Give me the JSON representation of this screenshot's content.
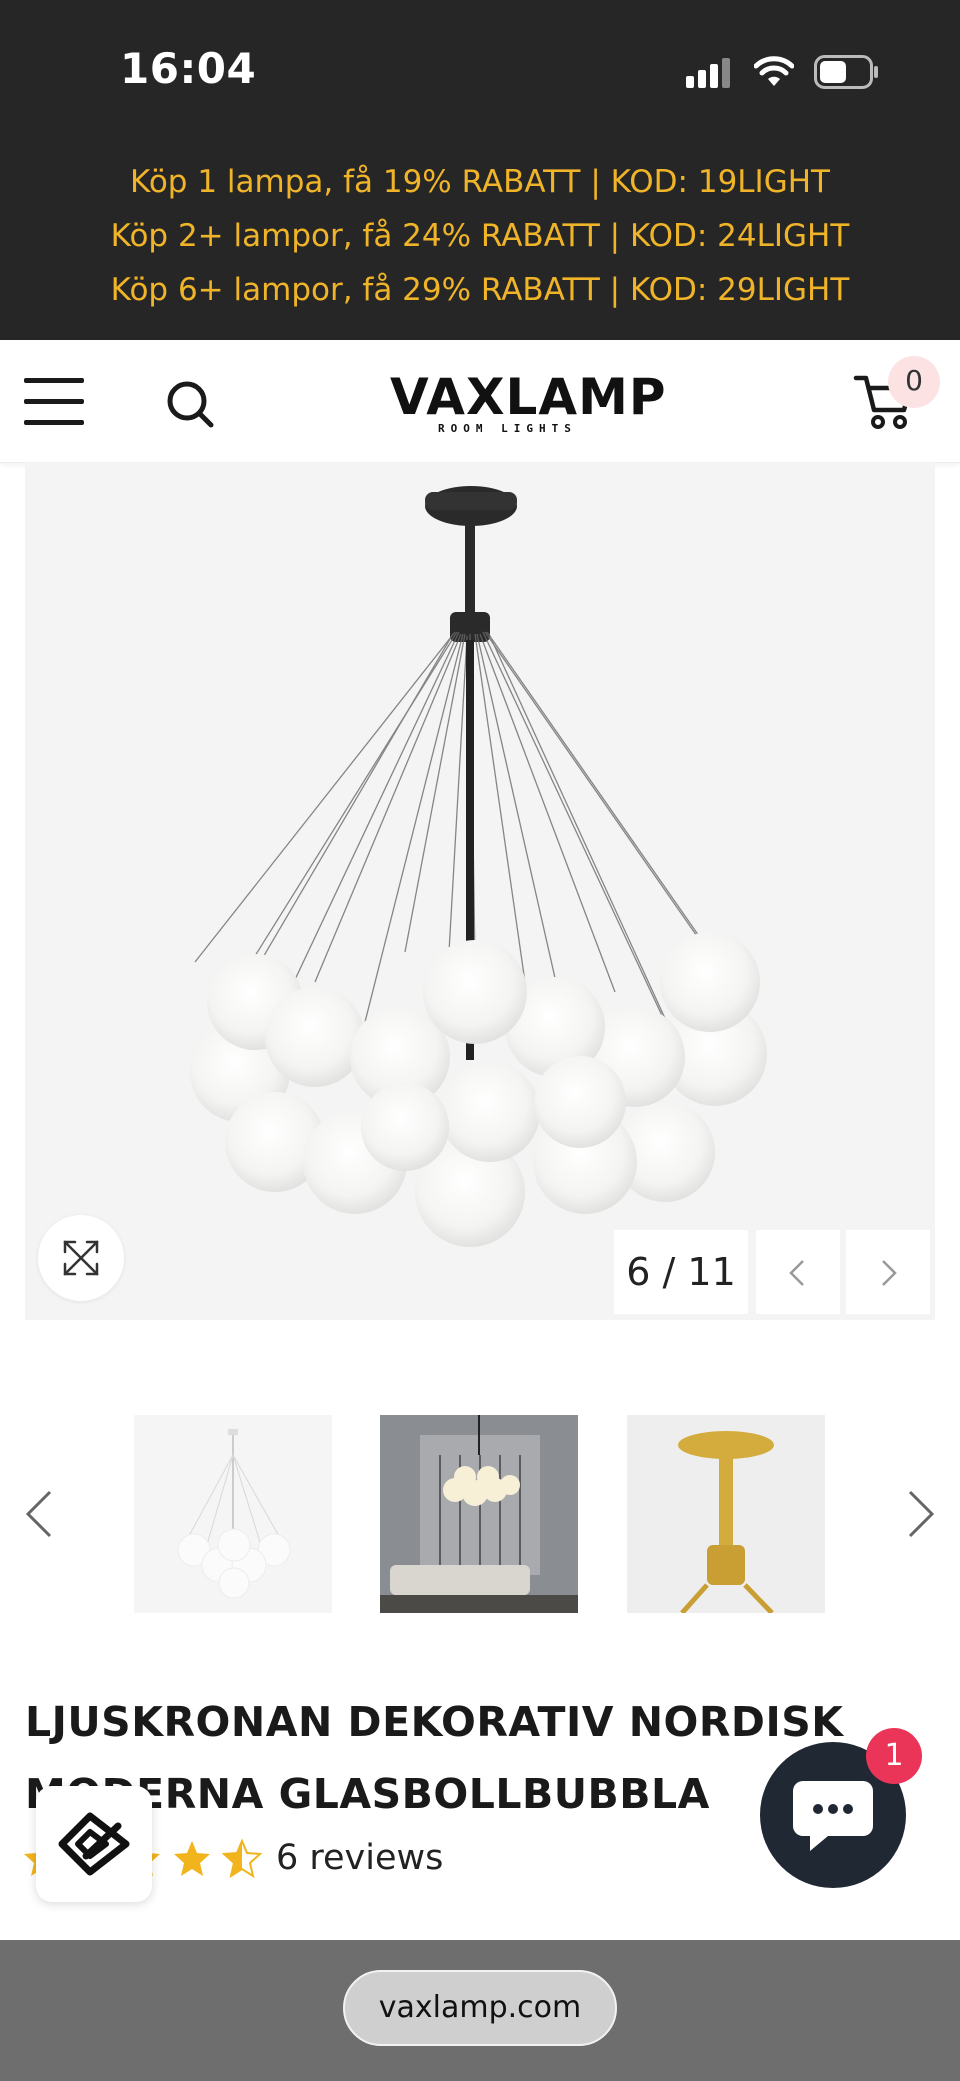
{
  "status_bar": {
    "time": "16:04"
  },
  "promo": {
    "lines": [
      "Köp 1 lampa, få 19% RABATT | KOD: 19LIGHT",
      "Köp 2+ lampor, få 24% RABATT | KOD: 24LIGHT",
      "Köp 6+ lampor, få 29% RABATT | KOD: 29LIGHT"
    ],
    "color": "#f0b429"
  },
  "header": {
    "logo": "VAXLAMP",
    "logo_sub": "ROOM LIGHTS",
    "cart_count": "0",
    "icons": [
      "hamburger-menu-icon",
      "search-icon",
      "cart-icon"
    ]
  },
  "gallery": {
    "counter": "6 / 11",
    "icons": [
      "expand-icon",
      "chevron-left-icon",
      "chevron-right-icon"
    ]
  },
  "product": {
    "title_line1": "LJUSKRONAN DEKORATIV NORDISK",
    "title_line2": "MODERNA GLASBOLLBUBBLA",
    "rating": 4.5,
    "reviews": "6 reviews"
  },
  "chat": {
    "badge": "1"
  },
  "browser": {
    "url": "vaxlamp.com"
  },
  "colors": {
    "dark": "#262626",
    "promo": "#f0b429",
    "star": "#f2b41c",
    "chat": "#1f2833",
    "badge": "#ea3559"
  }
}
